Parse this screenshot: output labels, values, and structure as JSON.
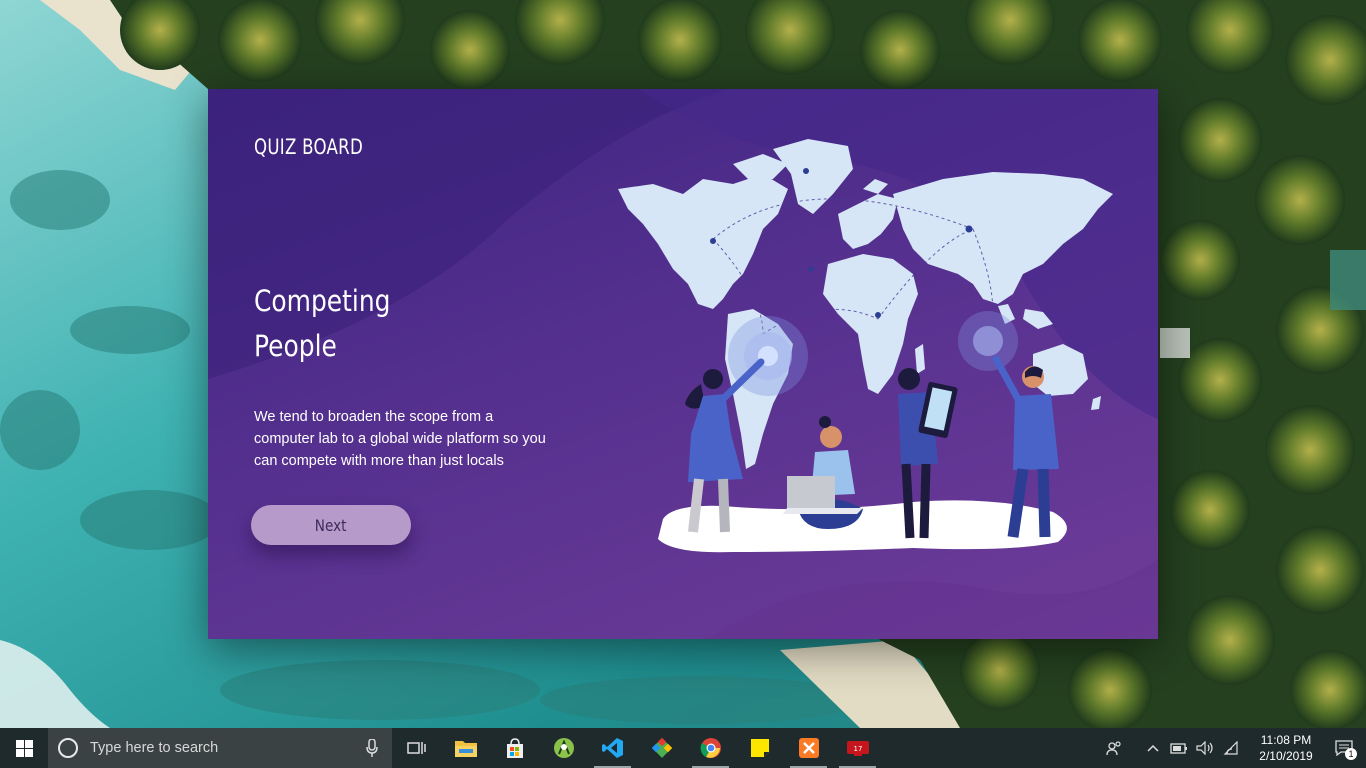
{
  "app": {
    "brand": "QUIZ BOARD",
    "headline_line1": "Competing",
    "headline_line2": "People",
    "description": "We tend to broaden the scope from a computer lab to a global wide platform so you can compete with more than just locals",
    "next_label": "Next"
  },
  "taskbar": {
    "search_placeholder": "Type here to search",
    "pinned_apps": [
      "task-view-icon",
      "file-explorer-icon",
      "store-icon",
      "android-studio-icon",
      "vscode-icon",
      "git-icon",
      "chrome-icon",
      "sticky-notes-icon",
      "xampp-icon",
      "media-app-icon"
    ],
    "clock_time": "11:08 PM",
    "clock_date": "2/10/2019",
    "notification_count": "1"
  },
  "colors": {
    "panel_top": "#3d2480",
    "panel_bottom": "#6f3c98",
    "button": "#b69ac9",
    "map": "#d6e6f6",
    "taskbar": "#1f2a2c"
  }
}
